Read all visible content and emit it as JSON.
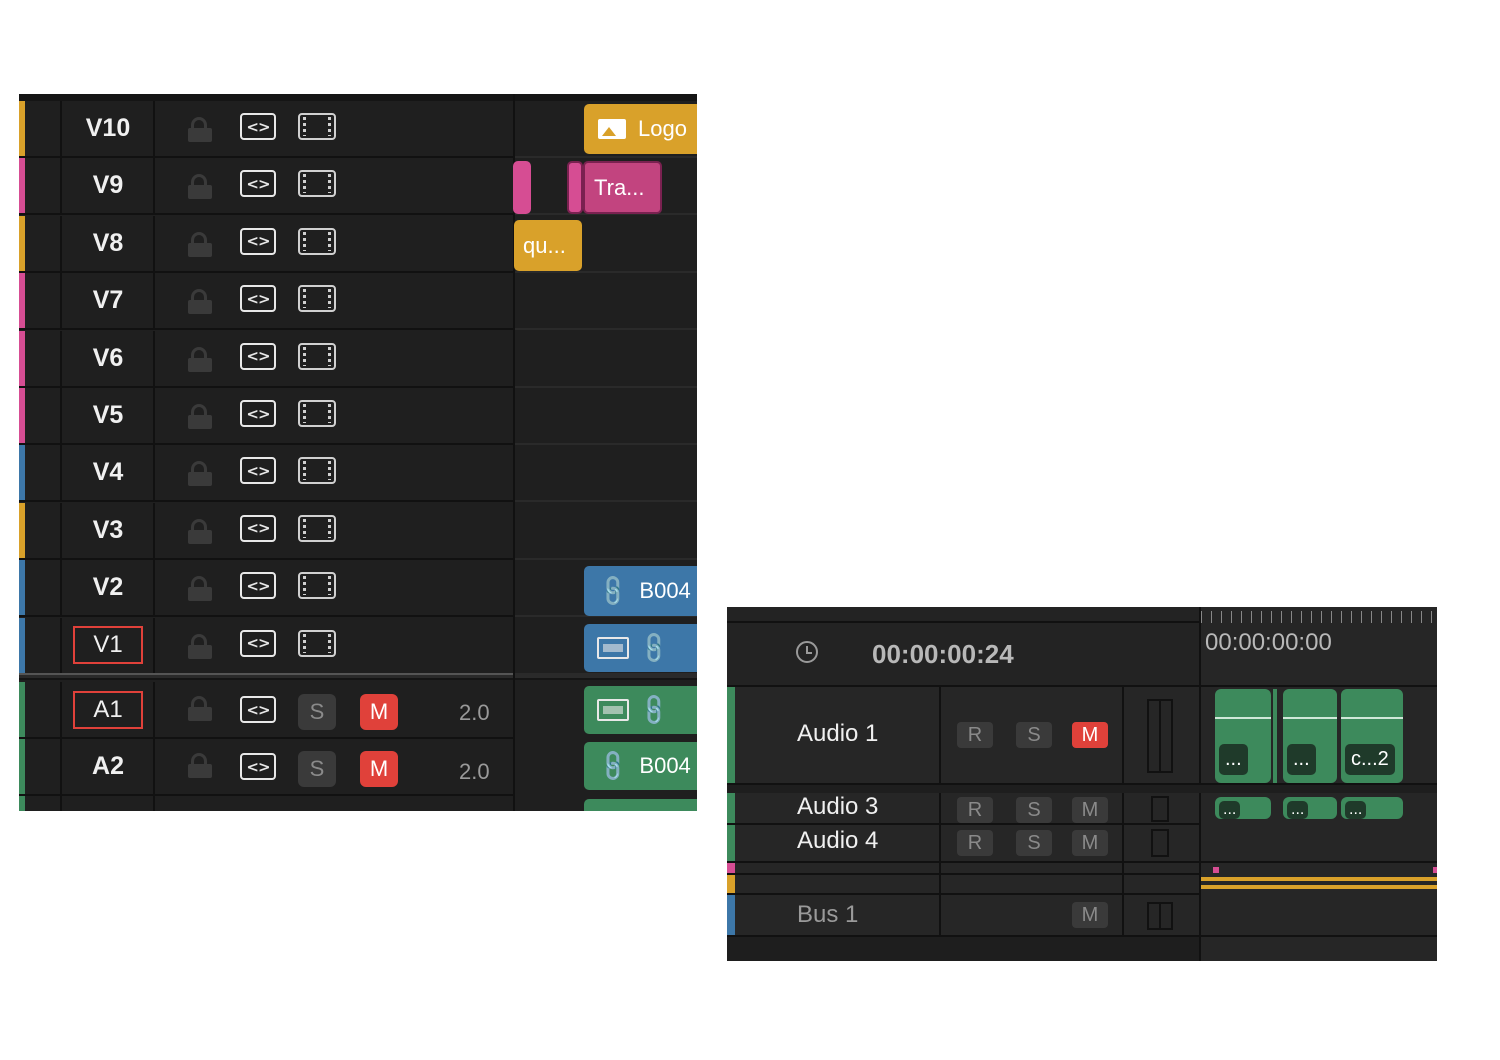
{
  "video_tracks": [
    {
      "name": "V10",
      "color": "#d9a12a"
    },
    {
      "name": "V9",
      "color": "#d64d93"
    },
    {
      "name": "V8",
      "color": "#d9a12a"
    },
    {
      "name": "V7",
      "color": "#d64d93"
    },
    {
      "name": "V6",
      "color": "#d64d93"
    },
    {
      "name": "V5",
      "color": "#d64d93"
    },
    {
      "name": "V4",
      "color": "#3d77a8"
    },
    {
      "name": "V3",
      "color": "#d9a12a"
    },
    {
      "name": "V2",
      "color": "#3d77a8"
    },
    {
      "name": "V1",
      "color": "#3d77a8"
    }
  ],
  "audio_tracks_left": [
    {
      "name": "A1",
      "s": "S",
      "m": "M",
      "channels": "2.0",
      "color": "#3d8a5c"
    },
    {
      "name": "A2",
      "s": "S",
      "m": "M",
      "channels": "2.0",
      "color": "#3d8a5c"
    }
  ],
  "clips_left": {
    "logo": "Logo",
    "tra": "Tra...",
    "qu": "qu...",
    "b004_v2": "B004",
    "b004_a2": "B004"
  },
  "timecode": {
    "current": "00:00:00:24",
    "ruler_start": "00:00:00:00"
  },
  "audio_tracks_right": [
    {
      "name": "Audio 1",
      "r": "R",
      "s": "S",
      "m": "M",
      "mute_active": true
    },
    {
      "name": "Audio 3",
      "r": "R",
      "s": "S",
      "m": "M",
      "mute_active": false
    },
    {
      "name": "Audio 4",
      "r": "R",
      "s": "S",
      "m": "M",
      "mute_active": false
    }
  ],
  "bus": {
    "name": "Bus 1",
    "m": "M"
  },
  "clips_right": {
    "audio1_a": "...",
    "audio1_b": "...",
    "audio1_c": "c...2",
    "audio3_a": "...",
    "audio3_b": "...",
    "audio3_c": "..."
  },
  "colors": {
    "mute_red": "#e0413a",
    "audio_green": "#3d8a5c",
    "video_blue": "#3d77a8",
    "pink": "#d64d93",
    "gold": "#d9a12a"
  }
}
